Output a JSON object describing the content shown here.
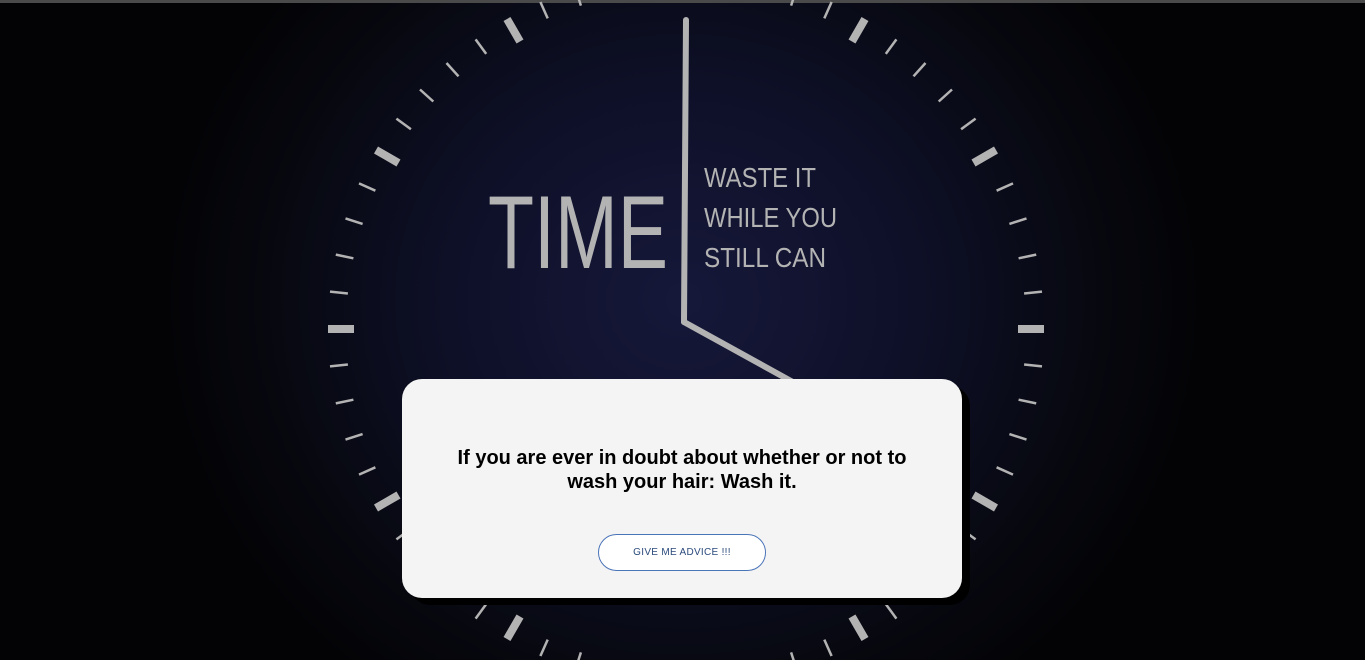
{
  "background": {
    "headline": "TIME",
    "tagline_lines": [
      "WASTE IT",
      "WHILE YOU",
      "STILL CAN"
    ]
  },
  "advice": {
    "text": "If you are ever in doubt about whether or not to wash your hair: Wash it.",
    "button_label": "GIVE ME ADVICE !!!"
  },
  "colors": {
    "card_background": "#f4f4f4",
    "button_border": "#4a74b8",
    "clock_marks": "#b3b3b3"
  }
}
